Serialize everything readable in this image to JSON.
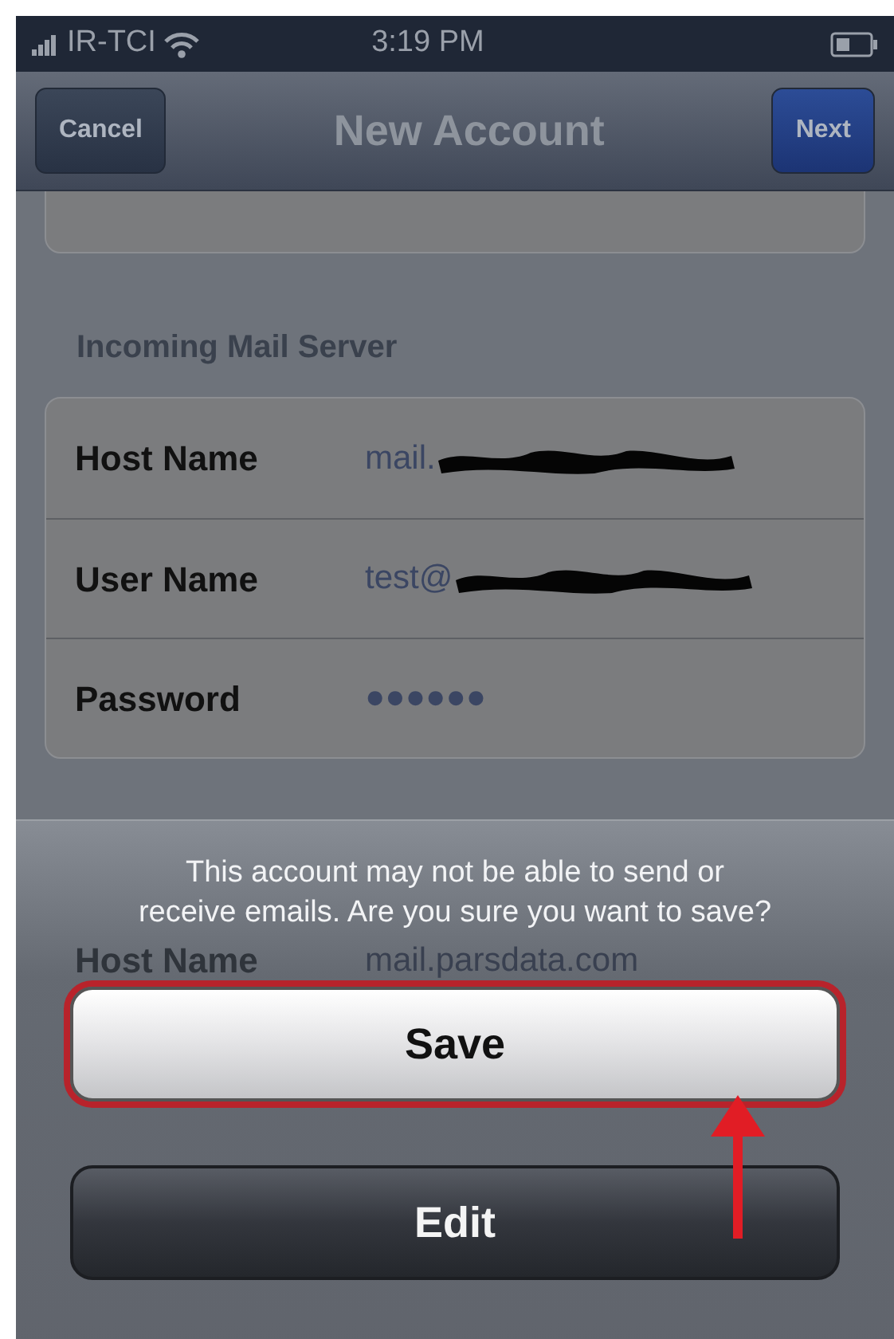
{
  "status_bar": {
    "carrier": "IR-TCI",
    "time": "3:19 PM"
  },
  "nav_bar": {
    "left_button": "Cancel",
    "title": "New Account",
    "right_button": "Next"
  },
  "sections": [
    {
      "header": "Incoming Mail Server",
      "rows": [
        {
          "label": "Host Name",
          "value": "mail.",
          "redacted": true
        },
        {
          "label": "User Name",
          "value": "test@",
          "redacted": true
        },
        {
          "label": "Password",
          "value": "●●●●●●",
          "redacted": false
        }
      ]
    },
    {
      "rows": [
        {
          "label": "Host Name",
          "value": "mail.parsdata.com",
          "redacted": false,
          "dimmed": true
        }
      ]
    }
  ],
  "action_sheet": {
    "message": "This account may not be able to send or\nreceive emails. Are you sure you want to save?",
    "buttons": [
      {
        "label": "Save",
        "kind": "light",
        "highlighted": true
      },
      {
        "label": "Edit",
        "kind": "dark",
        "highlighted": false
      }
    ]
  }
}
